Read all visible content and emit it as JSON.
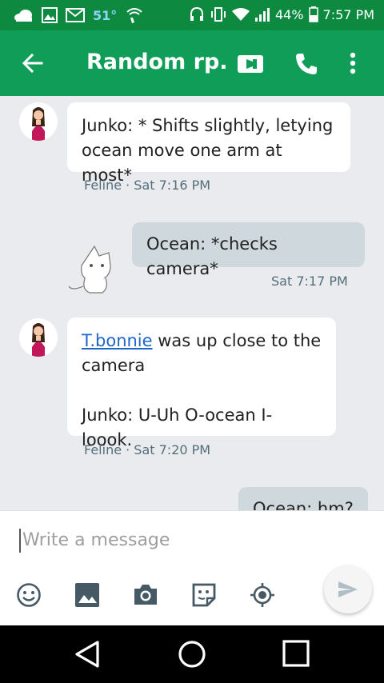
{
  "status_bar": {
    "temperature": "51°",
    "battery": "44%",
    "time": "7:57 PM",
    "icons": [
      "cloud-icon",
      "image-icon",
      "gmail-icon",
      "wifi-call-icon",
      "headset-icon",
      "vibrate-icon",
      "wifi-icon",
      "signal-icon",
      "battery-icon"
    ]
  },
  "app_bar": {
    "title": "Random rp...",
    "back_icon": "arrow-left-icon",
    "video_icon": "videocam-icon",
    "phone_icon": "phone-icon",
    "more_icon": "more-vert-icon",
    "color": "#0f9d58"
  },
  "messages": [
    {
      "direction": "incoming",
      "text_lines": [
        "Junko: * Shifts slightly, letying",
        "ocean move one arm at most*"
      ],
      "meta": "Feline · Sat 7:16 PM"
    },
    {
      "direction": "outgoing",
      "text_lines": [
        "Ocean: *checks camera*"
      ],
      "meta": "Sat 7:17 PM"
    },
    {
      "direction": "incoming",
      "mention": "T.bonnie",
      "text_after_mention": " was up close to the",
      "text_lines": [
        "camera",
        "",
        "Junko: U-Uh O-ocean I-loook."
      ],
      "meta": "Feline · Sat 7:20 PM"
    },
    {
      "direction": "outgoing",
      "text_lines": [
        "Ocean: hm?"
      ]
    }
  ],
  "composer": {
    "placeholder": "Write a message",
    "tools": [
      "emoji-icon",
      "image-icon",
      "camera-icon",
      "sticker-icon",
      "location-icon"
    ],
    "send_icon": "send-icon"
  },
  "nav_bar": {
    "icons": [
      "back-triangle-icon",
      "home-circle-icon",
      "recents-square-icon"
    ]
  }
}
